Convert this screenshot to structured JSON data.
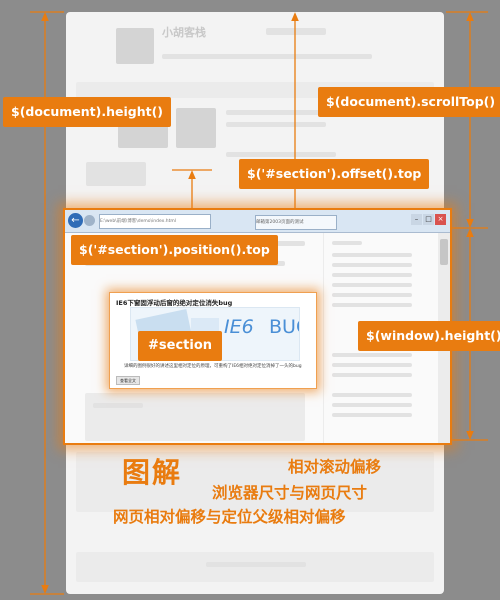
{
  "labels": {
    "document_height": "$(document).height()",
    "document_scrolltop": "$(document).scrollTop()",
    "section_offset_top": "$('#section').offset().top",
    "section_position_top": "$('#section').position().top",
    "window_height": "$(window).height()",
    "section": "#section"
  },
  "background_page": {
    "site_name": "小胡客栈"
  },
  "browser": {
    "address": "E:\\web\\前端\\博客\\demo\\index.html",
    "tab": "邮箱第2003页面的测试",
    "back_icon": "back-arrow-icon"
  },
  "section_box": {
    "title": "IE6下窗固浮动后窗的绝对定位消失bug",
    "img_ie6": "IE6",
    "img_bug": "BUG",
    "desc": "详细的图例很好的讲述这里相对定位的原理，可重构了IE6相对绝对定位消掉了一头的bug",
    "button": "查看全文"
  },
  "footer_text": {
    "title": "图解",
    "line1": "相对滚动偏移",
    "line2": "浏览器尺寸与网页尺寸",
    "line3": "网页相对偏移与定位父级相对偏移"
  },
  "colors": {
    "accent": "#e97c10",
    "background": "#8c8c8c",
    "page": "#f3f3f3"
  }
}
